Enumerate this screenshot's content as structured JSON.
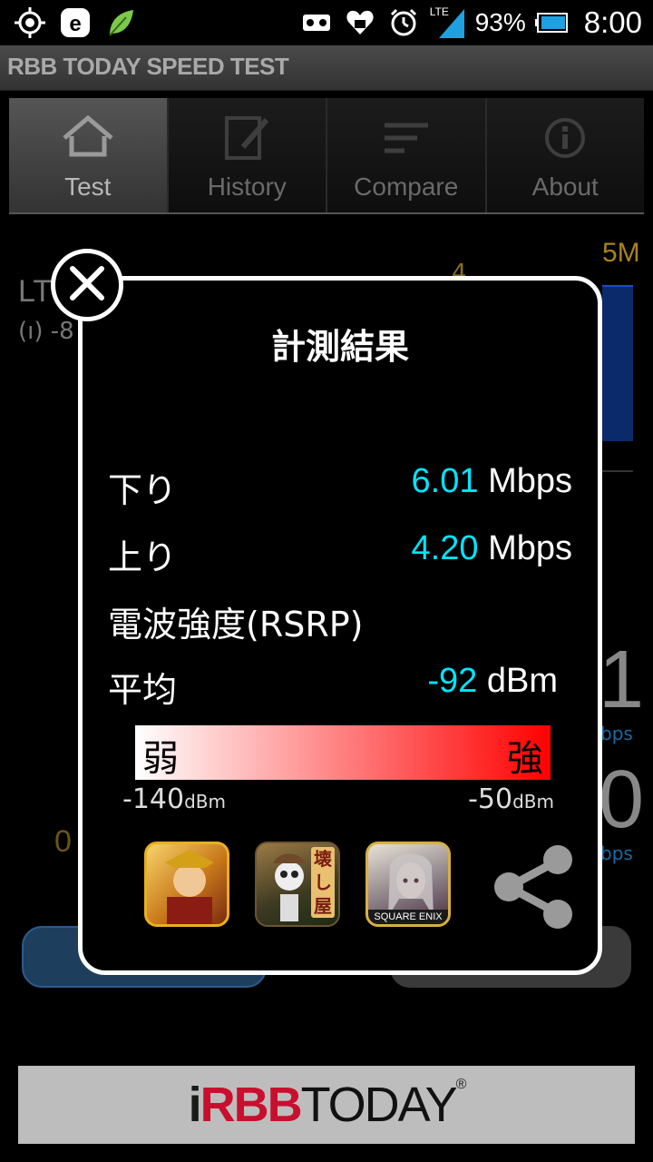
{
  "statusbar": {
    "battery_percent": "93%",
    "time": "8:00",
    "network_label": "LTE",
    "icons": [
      "gps-icon",
      "e-app-icon",
      "leaf-icon",
      "voicemail-icon",
      "heart-app-icon",
      "alarm-icon",
      "lte-signal-icon",
      "battery-icon"
    ]
  },
  "titlebar": {
    "title": "RBB TODAY SPEED TEST"
  },
  "tabs": [
    {
      "label": "Test",
      "icon": "home-icon",
      "active": true
    },
    {
      "label": "History",
      "icon": "edit-icon",
      "active": false
    },
    {
      "label": "Compare",
      "icon": "lines-icon",
      "active": false
    },
    {
      "label": "About",
      "icon": "info-icon",
      "active": false
    }
  ],
  "background": {
    "network": "LT",
    "signal_text": "-8",
    "scale_mid": "4",
    "scale_max": "5M",
    "big_digit_1": "1",
    "big_digit_2": "0",
    "mbps_1": "bps",
    "mbps_2": "bps",
    "zero_label": "0"
  },
  "modal": {
    "title": "計測結果",
    "download": {
      "label": "下り",
      "value": "6.01",
      "unit": "Mbps"
    },
    "upload": {
      "label": "上り",
      "value": "4.20",
      "unit": "Mbps"
    },
    "signal_strength_label": "電波強度(RSRP)",
    "average": {
      "label": "平均",
      "value": "-92",
      "unit": "dBm"
    },
    "gauge": {
      "weak_label": "弱",
      "strong_label": "強",
      "min": "-140",
      "max": "-50",
      "unit": "dBm",
      "colors": {
        "start": "#ffffff",
        "end": "#ff0000"
      }
    },
    "apps": [
      {
        "name": "samurai-app-icon"
      },
      {
        "name": "skeleton-app-icon",
        "text": "壊し屋"
      },
      {
        "name": "square-enix-app-icon",
        "badge": "SQUARE ENIX"
      }
    ],
    "accent_color": "#00e5ff"
  },
  "banner": {
    "logo_i": "i",
    "logo_rbb": "RBB",
    "logo_today": "TODAY",
    "logo_reg": "®"
  }
}
